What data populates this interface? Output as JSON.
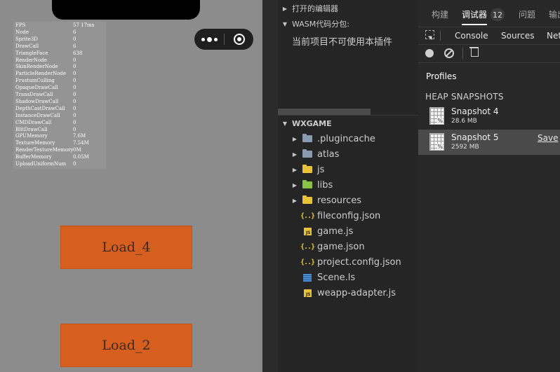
{
  "simulator": {
    "stats": [
      {
        "k": "FPS",
        "v": "57 17ms"
      },
      {
        "k": "Node",
        "v": "6"
      },
      {
        "k": "Sprite3D",
        "v": "0"
      },
      {
        "k": "DrawCall",
        "v": "6"
      },
      {
        "k": "TriangleFace",
        "v": "638"
      },
      {
        "k": "RenderNode",
        "v": "0"
      },
      {
        "k": "SkinRenderNode",
        "v": "0"
      },
      {
        "k": "ParticleRenderNode",
        "v": "0"
      },
      {
        "k": "FrustumCulling",
        "v": "0"
      },
      {
        "k": "OpaqueDrawCall",
        "v": "0"
      },
      {
        "k": "TransDrawCall",
        "v": "0"
      },
      {
        "k": "ShadowDrawCall",
        "v": "0"
      },
      {
        "k": "DepthCastDrawCall",
        "v": "0"
      },
      {
        "k": "InstanceDrawCall",
        "v": "0"
      },
      {
        "k": "CMDDrawCall",
        "v": "0"
      },
      {
        "k": "BlitDrawCall",
        "v": "0"
      },
      {
        "k": "GPUMemory",
        "v": "7.6M"
      },
      {
        "k": "TextureMemory",
        "v": "7.54M"
      },
      {
        "k": "RenderTextureMemory",
        "v": "0M"
      },
      {
        "k": "BufferMemory",
        "v": "0.05M"
      },
      {
        "k": "UploadUniformNum",
        "v": "0"
      }
    ],
    "buttons": {
      "load4": "Load_4",
      "load2": "Load_2"
    },
    "capsule": {
      "more_icon": "more-dots-icon",
      "close_icon": "close-circle-icon"
    }
  },
  "explorer": {
    "open_editors": "打开的编辑器",
    "wasm_section": "WASM代码分包:",
    "plugin_message": "当前项目不可使用本插件",
    "project_root": "WXGAME",
    "tree": [
      {
        "label": ".plugincache",
        "type": "folder",
        "color": "#8a9bb0",
        "expandable": true
      },
      {
        "label": "atlas",
        "type": "folder",
        "color": "#8a9bb0",
        "expandable": true
      },
      {
        "label": "js",
        "type": "folder",
        "color": "#e8c33a",
        "expandable": true
      },
      {
        "label": "libs",
        "type": "folder",
        "color": "#8bc34a",
        "expandable": true
      },
      {
        "label": "resources",
        "type": "folder",
        "color": "#e8c33a",
        "expandable": true
      },
      {
        "label": "fileconfig.json",
        "type": "json",
        "expandable": false
      },
      {
        "label": "game.js",
        "type": "js",
        "expandable": false
      },
      {
        "label": "game.json",
        "type": "json",
        "expandable": false
      },
      {
        "label": "project.config.json",
        "type": "json",
        "expandable": false
      },
      {
        "label": "Scene.ls",
        "type": "ls",
        "expandable": false
      },
      {
        "label": "weapp-adapter.js",
        "type": "js",
        "expandable": false
      }
    ]
  },
  "devtools": {
    "tabs": {
      "build": "构建",
      "debugger": "调试器",
      "badge": "12",
      "issues": "问题",
      "output": "输出"
    },
    "subtabs": {
      "console": "Console",
      "sources": "Sources",
      "network": "Network"
    },
    "profiles_label": "Profiles",
    "heap_header": "HEAP SNAPSHOTS",
    "snapshots": [
      {
        "name": "Snapshot 4",
        "size": "28.6 MB"
      },
      {
        "name": "Snapshot 5",
        "size": "2592 MB",
        "save": "Save"
      }
    ],
    "colors": {
      "accent_button": "#d65f1f",
      "sim_bg": "#8c8c8c"
    }
  }
}
